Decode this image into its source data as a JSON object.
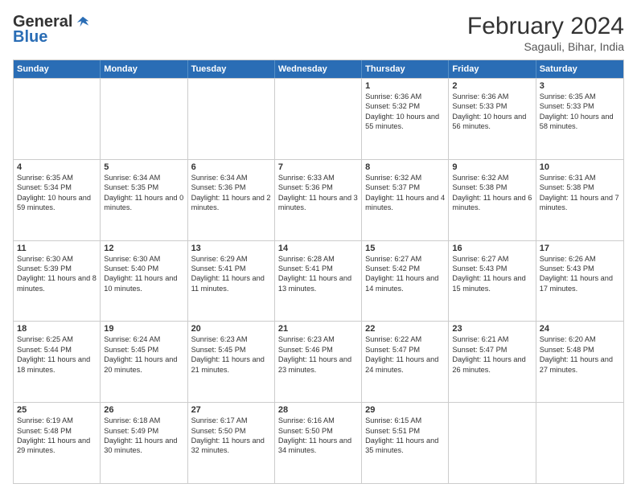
{
  "header": {
    "logo_general": "General",
    "logo_blue": "Blue",
    "title": "February 2024",
    "location": "Sagauli, Bihar, India"
  },
  "weekdays": [
    "Sunday",
    "Monday",
    "Tuesday",
    "Wednesday",
    "Thursday",
    "Friday",
    "Saturday"
  ],
  "rows": [
    [
      {
        "day": "",
        "info": ""
      },
      {
        "day": "",
        "info": ""
      },
      {
        "day": "",
        "info": ""
      },
      {
        "day": "",
        "info": ""
      },
      {
        "day": "1",
        "info": "Sunrise: 6:36 AM\nSunset: 5:32 PM\nDaylight: 10 hours and 55 minutes."
      },
      {
        "day": "2",
        "info": "Sunrise: 6:36 AM\nSunset: 5:33 PM\nDaylight: 10 hours and 56 minutes."
      },
      {
        "day": "3",
        "info": "Sunrise: 6:35 AM\nSunset: 5:33 PM\nDaylight: 10 hours and 58 minutes."
      }
    ],
    [
      {
        "day": "4",
        "info": "Sunrise: 6:35 AM\nSunset: 5:34 PM\nDaylight: 10 hours and 59 minutes."
      },
      {
        "day": "5",
        "info": "Sunrise: 6:34 AM\nSunset: 5:35 PM\nDaylight: 11 hours and 0 minutes."
      },
      {
        "day": "6",
        "info": "Sunrise: 6:34 AM\nSunset: 5:36 PM\nDaylight: 11 hours and 2 minutes."
      },
      {
        "day": "7",
        "info": "Sunrise: 6:33 AM\nSunset: 5:36 PM\nDaylight: 11 hours and 3 minutes."
      },
      {
        "day": "8",
        "info": "Sunrise: 6:32 AM\nSunset: 5:37 PM\nDaylight: 11 hours and 4 minutes."
      },
      {
        "day": "9",
        "info": "Sunrise: 6:32 AM\nSunset: 5:38 PM\nDaylight: 11 hours and 6 minutes."
      },
      {
        "day": "10",
        "info": "Sunrise: 6:31 AM\nSunset: 5:38 PM\nDaylight: 11 hours and 7 minutes."
      }
    ],
    [
      {
        "day": "11",
        "info": "Sunrise: 6:30 AM\nSunset: 5:39 PM\nDaylight: 11 hours and 8 minutes."
      },
      {
        "day": "12",
        "info": "Sunrise: 6:30 AM\nSunset: 5:40 PM\nDaylight: 11 hours and 10 minutes."
      },
      {
        "day": "13",
        "info": "Sunrise: 6:29 AM\nSunset: 5:41 PM\nDaylight: 11 hours and 11 minutes."
      },
      {
        "day": "14",
        "info": "Sunrise: 6:28 AM\nSunset: 5:41 PM\nDaylight: 11 hours and 13 minutes."
      },
      {
        "day": "15",
        "info": "Sunrise: 6:27 AM\nSunset: 5:42 PM\nDaylight: 11 hours and 14 minutes."
      },
      {
        "day": "16",
        "info": "Sunrise: 6:27 AM\nSunset: 5:43 PM\nDaylight: 11 hours and 15 minutes."
      },
      {
        "day": "17",
        "info": "Sunrise: 6:26 AM\nSunset: 5:43 PM\nDaylight: 11 hours and 17 minutes."
      }
    ],
    [
      {
        "day": "18",
        "info": "Sunrise: 6:25 AM\nSunset: 5:44 PM\nDaylight: 11 hours and 18 minutes."
      },
      {
        "day": "19",
        "info": "Sunrise: 6:24 AM\nSunset: 5:45 PM\nDaylight: 11 hours and 20 minutes."
      },
      {
        "day": "20",
        "info": "Sunrise: 6:23 AM\nSunset: 5:45 PM\nDaylight: 11 hours and 21 minutes."
      },
      {
        "day": "21",
        "info": "Sunrise: 6:23 AM\nSunset: 5:46 PM\nDaylight: 11 hours and 23 minutes."
      },
      {
        "day": "22",
        "info": "Sunrise: 6:22 AM\nSunset: 5:47 PM\nDaylight: 11 hours and 24 minutes."
      },
      {
        "day": "23",
        "info": "Sunrise: 6:21 AM\nSunset: 5:47 PM\nDaylight: 11 hours and 26 minutes."
      },
      {
        "day": "24",
        "info": "Sunrise: 6:20 AM\nSunset: 5:48 PM\nDaylight: 11 hours and 27 minutes."
      }
    ],
    [
      {
        "day": "25",
        "info": "Sunrise: 6:19 AM\nSunset: 5:48 PM\nDaylight: 11 hours and 29 minutes."
      },
      {
        "day": "26",
        "info": "Sunrise: 6:18 AM\nSunset: 5:49 PM\nDaylight: 11 hours and 30 minutes."
      },
      {
        "day": "27",
        "info": "Sunrise: 6:17 AM\nSunset: 5:50 PM\nDaylight: 11 hours and 32 minutes."
      },
      {
        "day": "28",
        "info": "Sunrise: 6:16 AM\nSunset: 5:50 PM\nDaylight: 11 hours and 34 minutes."
      },
      {
        "day": "29",
        "info": "Sunrise: 6:15 AM\nSunset: 5:51 PM\nDaylight: 11 hours and 35 minutes."
      },
      {
        "day": "",
        "info": ""
      },
      {
        "day": "",
        "info": ""
      }
    ]
  ]
}
